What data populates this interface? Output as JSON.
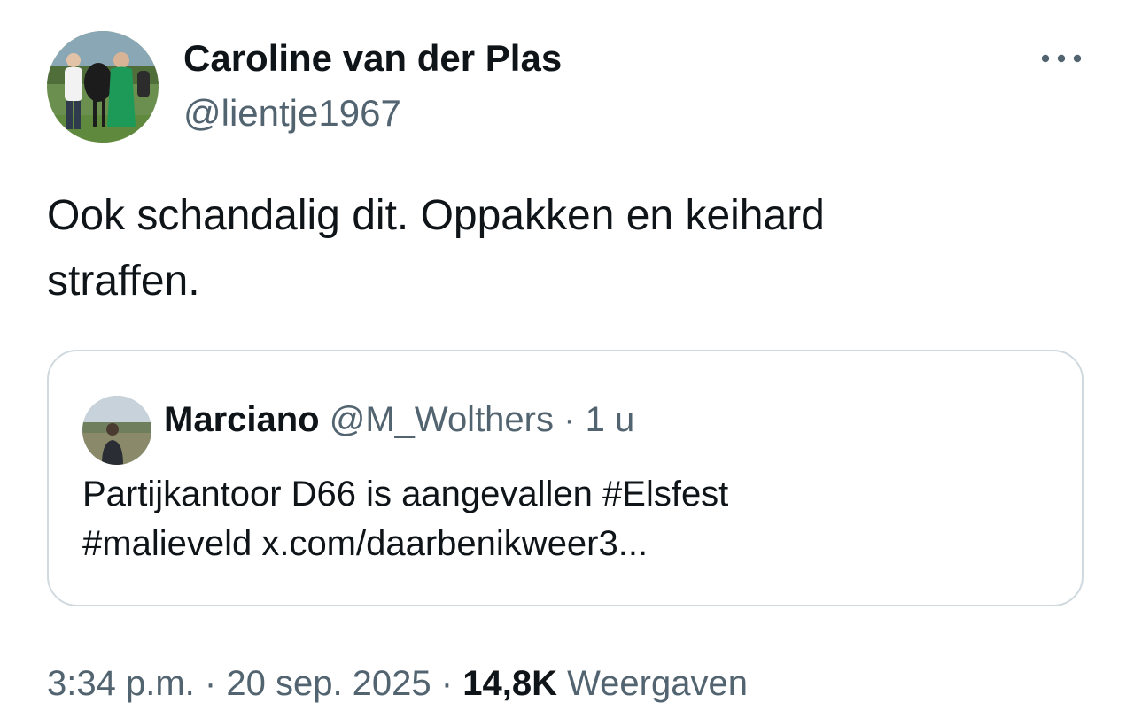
{
  "tweet": {
    "author": {
      "name": "Caroline van der Plas",
      "handle": "@lientje1967",
      "avatar_icon": "profile-photo"
    },
    "more_icon": "more-options-icon",
    "text_line1": "Ook schandalig dit. Oppakken en keihard",
    "text_line2": "straffen.",
    "quote": {
      "author_name": "Marciano",
      "author_handle": "@M_Wolthers",
      "separator": "·",
      "time": "1 u",
      "text_line1": "Partijkantoor D66 is aangevallen #Elsfest",
      "text_line2": "#malieveld x.com/daarbenikweer3..."
    },
    "footer": {
      "time": "3:34 p.m.",
      "separator": "·",
      "date": "20 sep. 2025",
      "views_count": "14,8K",
      "views_label": "Weergaven"
    }
  },
  "colors": {
    "text": "#0f1419",
    "secondary": "#536471",
    "border": "#cfd9de"
  }
}
